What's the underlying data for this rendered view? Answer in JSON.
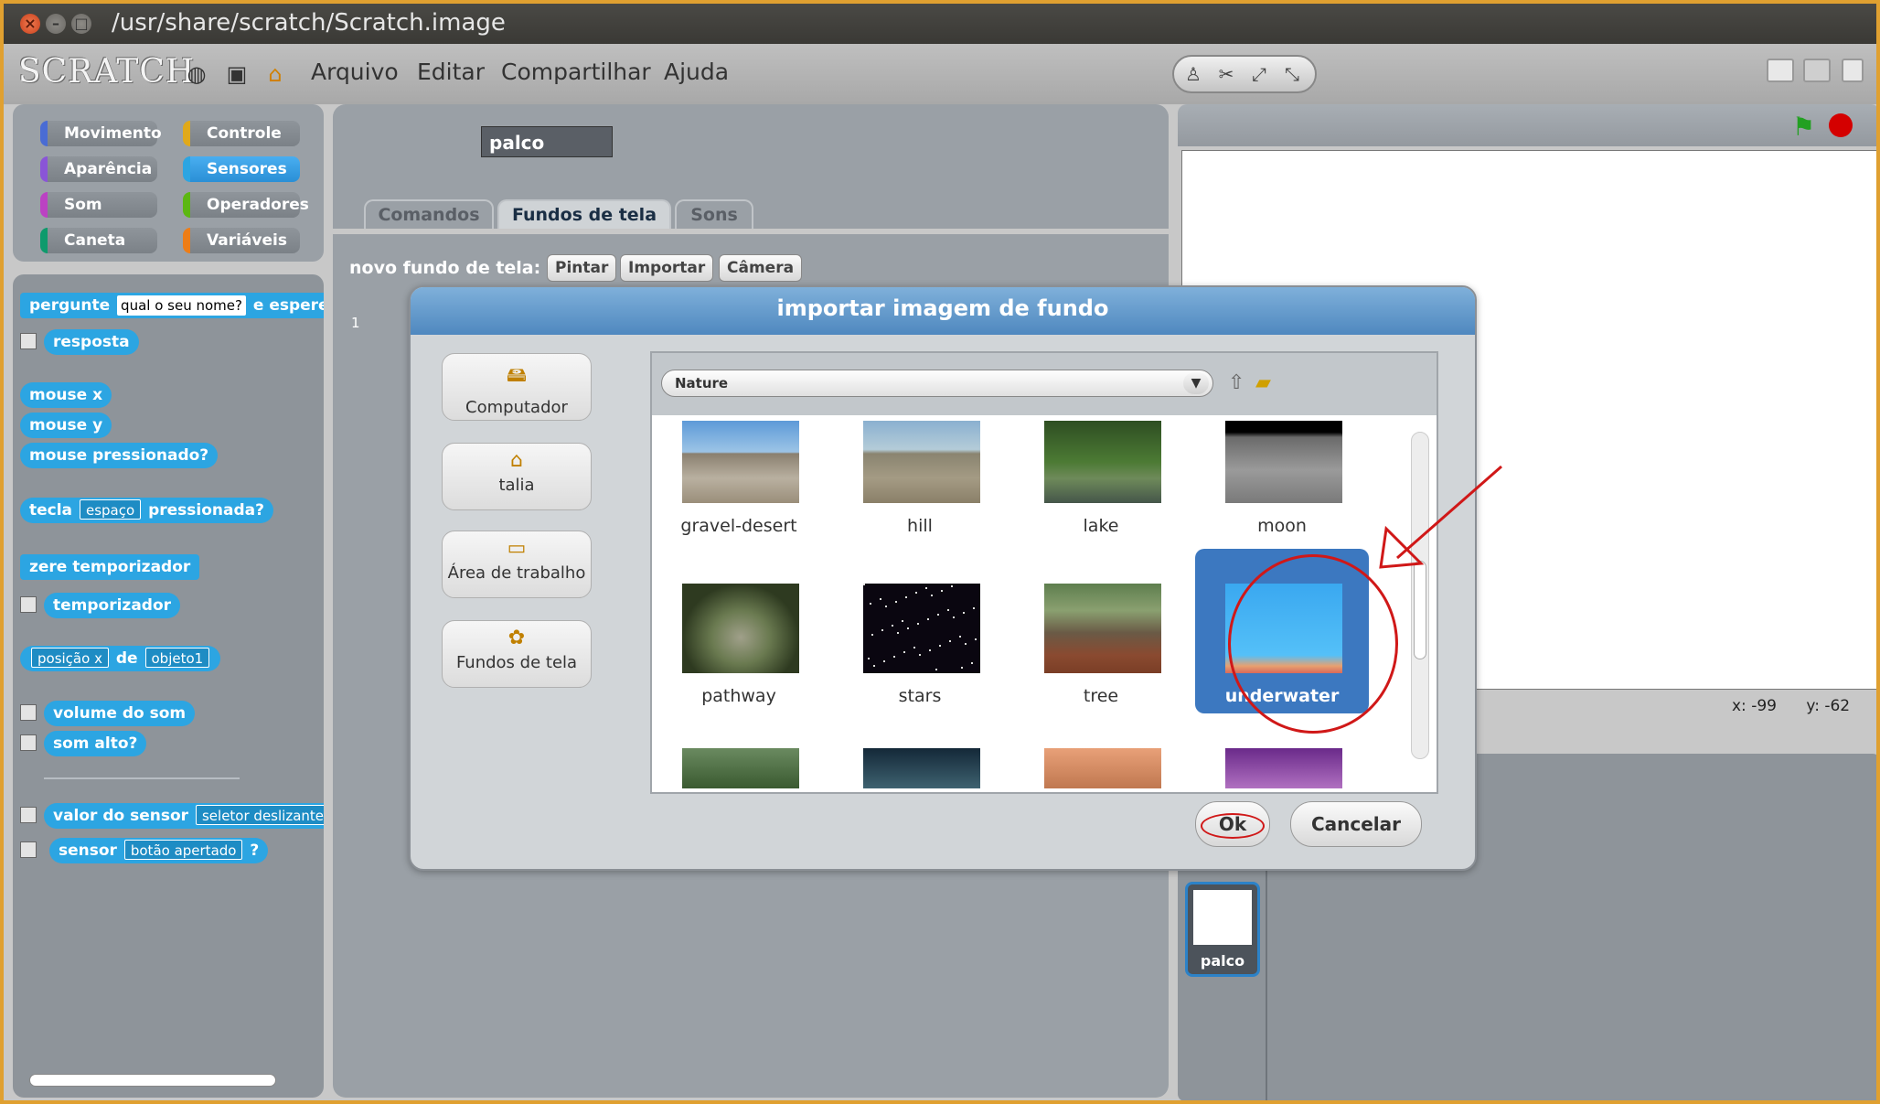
{
  "window": {
    "title": "/usr/share/scratch/Scratch.image"
  },
  "app": {
    "logo": "SCRATCH"
  },
  "menu": {
    "items": [
      "Arquivo",
      "Editar",
      "Compartilhar",
      "Ajuda"
    ]
  },
  "categories": [
    {
      "label": "Movimento",
      "color": "#4a6cd4"
    },
    {
      "label": "Controle",
      "color": "#e1a91a"
    },
    {
      "label": "Aparência",
      "color": "#8a55d7"
    },
    {
      "label": "Sensores",
      "color": "#2ca5e2"
    },
    {
      "label": "Som",
      "color": "#bb42c3"
    },
    {
      "label": "Operadores",
      "color": "#5cb712"
    },
    {
      "label": "Caneta",
      "color": "#0e9a6c"
    },
    {
      "label": "Variáveis",
      "color": "#ee7d16"
    }
  ],
  "blocks": {
    "ask": "pergunte",
    "ask_input": "qual o seu nome?",
    "ask_tail": "e espere",
    "answer": "resposta",
    "mouse_x": "mouse x",
    "mouse_y": "mouse y",
    "mouse_down": "mouse pressionado?",
    "key": "tecla",
    "key_dd": "espaço",
    "key_tail": "pressionada?",
    "reset_timer": "zere temporizador",
    "timer": "temporizador",
    "pos_dd": "posição x",
    "of": "de",
    "obj_dd": "objeto1",
    "loudness": "volume do som",
    "loud": "som alto?",
    "sensor_value": "valor do sensor",
    "sensor_dd": "seletor deslizante",
    "sensor": "sensor",
    "sensor_btn_dd": "botão apertado",
    "sensor_q": "?"
  },
  "sprite": {
    "name": "palco"
  },
  "tabs": [
    "Comandos",
    "Fundos de tela",
    "Sons"
  ],
  "new_bg": {
    "label": "novo fundo de tela:",
    "paint": "Pintar",
    "import": "Importar",
    "camera": "Câmera"
  },
  "list_index": "1",
  "stage": {
    "coords_x": "x: -99",
    "coords_y": "y: -62"
  },
  "thumb": {
    "label": "palco"
  },
  "dialog": {
    "title": "importar imagem de fundo",
    "places": [
      {
        "label": "Computador",
        "icon": "computer-icon"
      },
      {
        "label": "talia",
        "icon": "home-icon"
      },
      {
        "label": "Área de trabalho",
        "icon": "folder-icon"
      },
      {
        "label": "Fundos de tela",
        "icon": "backgrounds-icon"
      }
    ],
    "folder": "Nature",
    "items": [
      "gravel-desert",
      "hill",
      "lake",
      "moon",
      "pathway",
      "stars",
      "tree",
      "underwater"
    ],
    "selected": "underwater",
    "ok": "Ok",
    "cancel": "Cancelar"
  },
  "colors": {
    "accent": "#2ca5e2",
    "selection": "#3c78c0",
    "annotation": "#d01818"
  }
}
